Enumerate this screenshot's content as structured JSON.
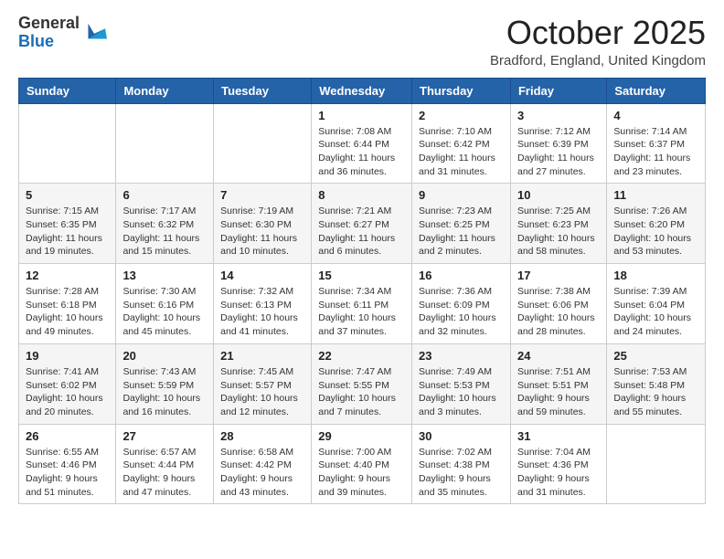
{
  "header": {
    "logo_general": "General",
    "logo_blue": "Blue",
    "month": "October 2025",
    "location": "Bradford, England, United Kingdom"
  },
  "days_of_week": [
    "Sunday",
    "Monday",
    "Tuesday",
    "Wednesday",
    "Thursday",
    "Friday",
    "Saturday"
  ],
  "weeks": [
    [
      {
        "day": "",
        "info": ""
      },
      {
        "day": "",
        "info": ""
      },
      {
        "day": "",
        "info": ""
      },
      {
        "day": "1",
        "info": "Sunrise: 7:08 AM\nSunset: 6:44 PM\nDaylight: 11 hours and 36 minutes."
      },
      {
        "day": "2",
        "info": "Sunrise: 7:10 AM\nSunset: 6:42 PM\nDaylight: 11 hours and 31 minutes."
      },
      {
        "day": "3",
        "info": "Sunrise: 7:12 AM\nSunset: 6:39 PM\nDaylight: 11 hours and 27 minutes."
      },
      {
        "day": "4",
        "info": "Sunrise: 7:14 AM\nSunset: 6:37 PM\nDaylight: 11 hours and 23 minutes."
      }
    ],
    [
      {
        "day": "5",
        "info": "Sunrise: 7:15 AM\nSunset: 6:35 PM\nDaylight: 11 hours and 19 minutes."
      },
      {
        "day": "6",
        "info": "Sunrise: 7:17 AM\nSunset: 6:32 PM\nDaylight: 11 hours and 15 minutes."
      },
      {
        "day": "7",
        "info": "Sunrise: 7:19 AM\nSunset: 6:30 PM\nDaylight: 11 hours and 10 minutes."
      },
      {
        "day": "8",
        "info": "Sunrise: 7:21 AM\nSunset: 6:27 PM\nDaylight: 11 hours and 6 minutes."
      },
      {
        "day": "9",
        "info": "Sunrise: 7:23 AM\nSunset: 6:25 PM\nDaylight: 11 hours and 2 minutes."
      },
      {
        "day": "10",
        "info": "Sunrise: 7:25 AM\nSunset: 6:23 PM\nDaylight: 10 hours and 58 minutes."
      },
      {
        "day": "11",
        "info": "Sunrise: 7:26 AM\nSunset: 6:20 PM\nDaylight: 10 hours and 53 minutes."
      }
    ],
    [
      {
        "day": "12",
        "info": "Sunrise: 7:28 AM\nSunset: 6:18 PM\nDaylight: 10 hours and 49 minutes."
      },
      {
        "day": "13",
        "info": "Sunrise: 7:30 AM\nSunset: 6:16 PM\nDaylight: 10 hours and 45 minutes."
      },
      {
        "day": "14",
        "info": "Sunrise: 7:32 AM\nSunset: 6:13 PM\nDaylight: 10 hours and 41 minutes."
      },
      {
        "day": "15",
        "info": "Sunrise: 7:34 AM\nSunset: 6:11 PM\nDaylight: 10 hours and 37 minutes."
      },
      {
        "day": "16",
        "info": "Sunrise: 7:36 AM\nSunset: 6:09 PM\nDaylight: 10 hours and 32 minutes."
      },
      {
        "day": "17",
        "info": "Sunrise: 7:38 AM\nSunset: 6:06 PM\nDaylight: 10 hours and 28 minutes."
      },
      {
        "day": "18",
        "info": "Sunrise: 7:39 AM\nSunset: 6:04 PM\nDaylight: 10 hours and 24 minutes."
      }
    ],
    [
      {
        "day": "19",
        "info": "Sunrise: 7:41 AM\nSunset: 6:02 PM\nDaylight: 10 hours and 20 minutes."
      },
      {
        "day": "20",
        "info": "Sunrise: 7:43 AM\nSunset: 5:59 PM\nDaylight: 10 hours and 16 minutes."
      },
      {
        "day": "21",
        "info": "Sunrise: 7:45 AM\nSunset: 5:57 PM\nDaylight: 10 hours and 12 minutes."
      },
      {
        "day": "22",
        "info": "Sunrise: 7:47 AM\nSunset: 5:55 PM\nDaylight: 10 hours and 7 minutes."
      },
      {
        "day": "23",
        "info": "Sunrise: 7:49 AM\nSunset: 5:53 PM\nDaylight: 10 hours and 3 minutes."
      },
      {
        "day": "24",
        "info": "Sunrise: 7:51 AM\nSunset: 5:51 PM\nDaylight: 9 hours and 59 minutes."
      },
      {
        "day": "25",
        "info": "Sunrise: 7:53 AM\nSunset: 5:48 PM\nDaylight: 9 hours and 55 minutes."
      }
    ],
    [
      {
        "day": "26",
        "info": "Sunrise: 6:55 AM\nSunset: 4:46 PM\nDaylight: 9 hours and 51 minutes."
      },
      {
        "day": "27",
        "info": "Sunrise: 6:57 AM\nSunset: 4:44 PM\nDaylight: 9 hours and 47 minutes."
      },
      {
        "day": "28",
        "info": "Sunrise: 6:58 AM\nSunset: 4:42 PM\nDaylight: 9 hours and 43 minutes."
      },
      {
        "day": "29",
        "info": "Sunrise: 7:00 AM\nSunset: 4:40 PM\nDaylight: 9 hours and 39 minutes."
      },
      {
        "day": "30",
        "info": "Sunrise: 7:02 AM\nSunset: 4:38 PM\nDaylight: 9 hours and 35 minutes."
      },
      {
        "day": "31",
        "info": "Sunrise: 7:04 AM\nSunset: 4:36 PM\nDaylight: 9 hours and 31 minutes."
      },
      {
        "day": "",
        "info": ""
      }
    ]
  ]
}
